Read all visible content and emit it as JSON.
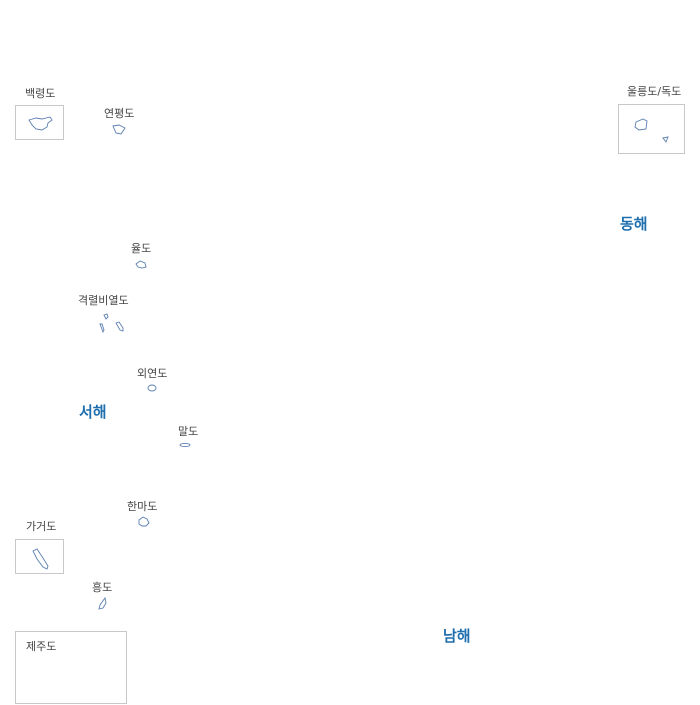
{
  "islands": {
    "baengnyeong": "백령도",
    "yeonpyeong": "연평도",
    "ulleung_dokdo": "울릉도/독도",
    "yul": "율도",
    "gyeongnyeolbiyeol": "격렬비열도",
    "oeyeon": "외연도",
    "mal": "말도",
    "hanma": "한마도",
    "gageo": "가거도",
    "hong": "흥도",
    "jeju": "제주도"
  },
  "seas": {
    "east": "동해",
    "west": "서해",
    "south": "남해"
  },
  "colors": {
    "sea_label": "#1f6fae",
    "island_outline": "#5b7fb0",
    "inset_border": "#c8c8c8"
  }
}
